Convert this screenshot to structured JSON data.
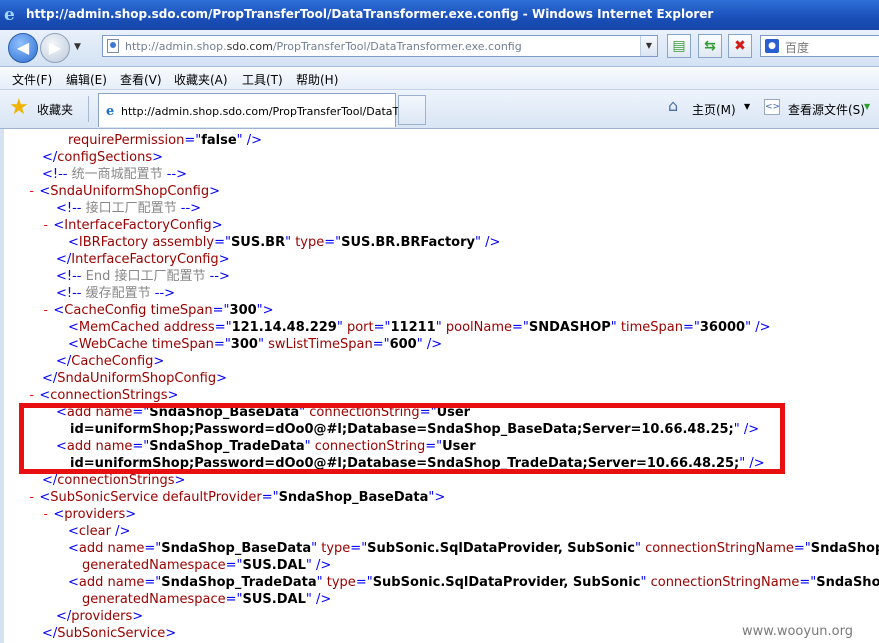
{
  "window": {
    "title": "http://admin.shop.sdo.com/PropTransferTool/DataTransformer.exe.config - Windows Internet Explorer"
  },
  "address": {
    "url_prefix": "http://admin.shop.",
    "url_domain": "sdo.com",
    "url_suffix": "/PropTransferTool/DataTransformer.exe.config"
  },
  "search": {
    "placeholder": "百度"
  },
  "menu": [
    "文件(F)",
    "编辑(E)",
    "查看(V)",
    "收藏夹(A)",
    "工具(T)",
    "帮助(H)"
  ],
  "favorites": {
    "label": "收藏夹",
    "tab_title": "http://admin.shop.sdo.com/PropTransferTool/DataTr...",
    "home_label": "主页(M)",
    "view_source_label": "查看源文件(S)"
  },
  "watermark": "www.wooyun.org",
  "colors": {
    "highlight_border": "#e80f10",
    "tag": "#990000",
    "bracket": "#0000ff",
    "comment": "#888888"
  },
  "xml": {
    "l01_a1n": "requirePermission",
    "l01_a1v": "false",
    "l02_tag": "configSections",
    "l03_comment": "统一商城配置节",
    "l04_tag": "SndaUniformShopConfig",
    "l05_comment": "接口工厂配置节",
    "l06_tag": "InterfaceFactoryConfig",
    "l07_tag": "IBRFactory",
    "l07_a1n": "assembly",
    "l07_a1v": "SUS.BR",
    "l07_a2n": "type",
    "l07_a2v": "SUS.BR.BRFactory",
    "l08_tag": "InterfaceFactoryConfig",
    "l09_comment": "End 接口工厂配置节",
    "l10_comment": "缓存配置节",
    "l11_tag": "CacheConfig",
    "l11_a1n": "timeSpan",
    "l11_a1v": "300",
    "l12_tag": "MemCached",
    "l12_a1n": "address",
    "l12_a1v": "121.14.48.229",
    "l12_a2n": "port",
    "l12_a2v": "11211",
    "l12_a3n": "poolName",
    "l12_a3v": "SNDASHOP",
    "l12_a4n": "timeSpan",
    "l12_a4v": "36000",
    "l13_tag": "WebCache",
    "l13_a1n": "timeSpan",
    "l13_a1v": "300",
    "l13_a2n": "swListTimeSpan",
    "l13_a2v": "600",
    "l14_tag": "CacheConfig",
    "l15_tag": "SndaUniformShopConfig",
    "l16_tag": "connectionStrings",
    "l17_tag": "add",
    "l17_a1n": "name",
    "l17_a1v": "SndaShop_BaseData",
    "l17_a2n": "connectionString",
    "l17_a2v": "User",
    "l18_text": "id=uniformShop;Password=dOo0@#l;Database=SndaShop_BaseData;Server=10.66.48.25;",
    "l19_tag": "add",
    "l19_a1n": "name",
    "l19_a1v": "SndaShop_TradeData",
    "l19_a2n": "connectionString",
    "l19_a2v": "User",
    "l20_text": "id=uniformShop;Password=dOo0@#l;Database=SndaShop_TradeData;Server=10.66.48.25;",
    "l21_tag": "connectionStrings",
    "l22_tag": "SubSonicService",
    "l22_a1n": "defaultProvider",
    "l22_a1v": "SndaShop_BaseData",
    "l23_tag": "providers",
    "l24_tag": "clear",
    "l25_tag": "add",
    "l25_a1n": "name",
    "l25_a1v": "SndaShop_BaseData",
    "l25_a2n": "type",
    "l25_a2v": "SubSonic.SqlDataProvider, SubSonic",
    "l25_a3n": "connectionStringName",
    "l25_a3v": "SndaShop_Ba",
    "l26_a1n": "generatedNamespace",
    "l26_a1v": "SUS.DAL",
    "l27_tag": "add",
    "l27_a1n": "name",
    "l27_a1v": "SndaShop_TradeData",
    "l27_a2n": "type",
    "l27_a2v": "SubSonic.SqlDataProvider, SubSonic",
    "l27_a3n": "connectionStringName",
    "l27_a3v": "SndaShop_",
    "l28_a1n": "generatedNamespace",
    "l28_a1v": "SUS.DAL",
    "l29_tag": "providers",
    "l30_tag": "SubSonicService"
  }
}
